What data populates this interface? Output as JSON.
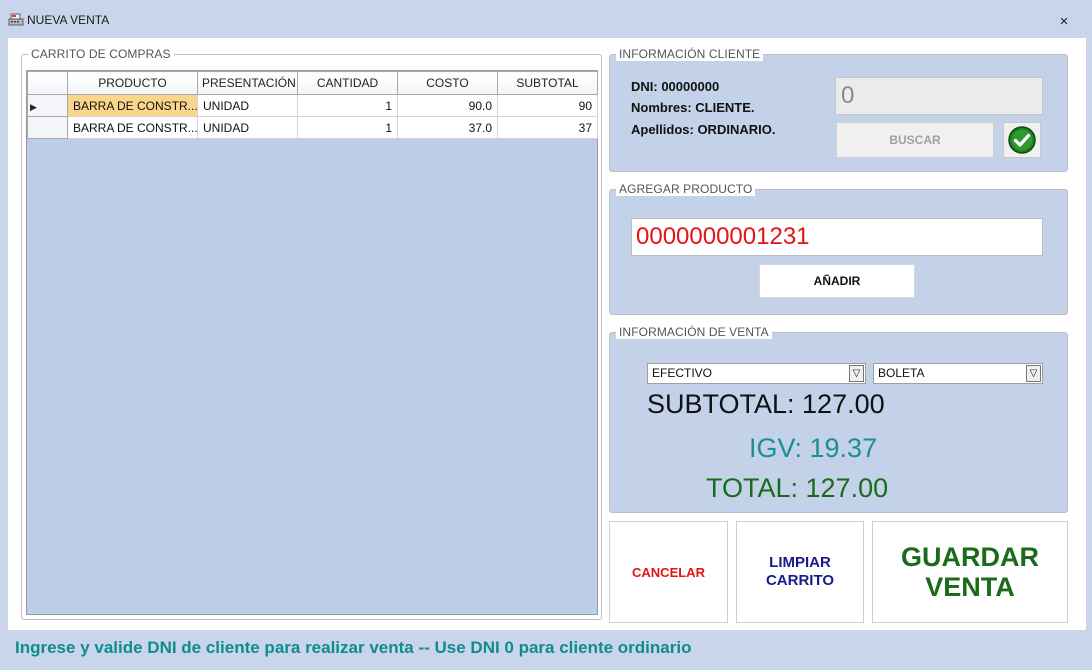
{
  "window": {
    "title": "NUEVA VENTA",
    "close_glyph": "×"
  },
  "cart": {
    "legend": "CARRITO DE COMPRAS",
    "columns": [
      "PRODUCTO",
      "PRESENTACIÓN",
      "CANTIDAD",
      "COSTO",
      "SUBTOTAL"
    ],
    "rows": [
      {
        "producto": "BARRA DE CONSTR...",
        "presentacion": "UNIDAD",
        "cantidad": "1",
        "costo": "90.0",
        "subtotal": "90"
      },
      {
        "producto": "BARRA DE CONSTR...",
        "presentacion": "UNIDAD",
        "cantidad": "1",
        "costo": "37.0",
        "subtotal": "37"
      }
    ]
  },
  "client": {
    "legend": "INFORMACIÓN CLIENTE",
    "dni_line": "DNI: 00000000",
    "nombres_line": "Nombres: CLIENTE.",
    "apellidos_line": "Apellidos: ORDINARIO.",
    "dni_input_value": "0",
    "search_button": "BUSCAR",
    "validate_icon": "check-circle-icon"
  },
  "product": {
    "legend": "AGREGAR PRODUCTO",
    "code_value": "0000000001231",
    "add_button": "AÑADIR"
  },
  "sale": {
    "legend": "INFORMACIÓN DE VENTA",
    "payment_method": "EFECTIVO",
    "document_type": "BOLETA",
    "subtotal_text": "SUBTOTAL: 127.00",
    "igv_text": "IGV: 19.37",
    "total_text": "TOTAL: 127.00"
  },
  "actions": {
    "cancel": "CANCELAR",
    "clear_cart_line1": "LIMPIAR",
    "clear_cart_line2": "CARRITO",
    "save_line1": "GUARDAR",
    "save_line2": "VENTA"
  },
  "status": {
    "message": "Ingrese y valide DNI de cliente para realizar venta -- Use DNI 0 para cliente ordinario"
  },
  "colors": {
    "product_code": "#e31313",
    "igv": "#1a8f97",
    "total": "#1a6b1a",
    "cancel": "#e31313",
    "clear_cart": "#1a1a8c",
    "save": "#1a6b1a",
    "status": "#0f8c8c"
  }
}
